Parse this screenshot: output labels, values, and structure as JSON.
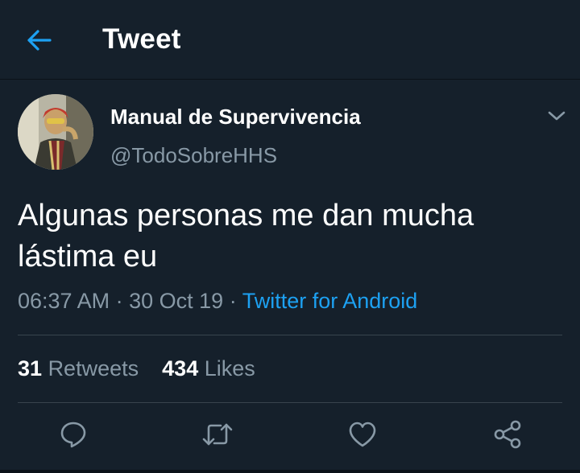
{
  "header": {
    "title": "Tweet",
    "back_icon": "arrow-left-icon"
  },
  "tweet": {
    "author": {
      "display_name": "Manual de Supervivencia",
      "handle": "@TodoSobreHHS"
    },
    "text_line1": "Algunas personas me dan mucha",
    "text_line2": "lástima eu",
    "time": "06:37 AM",
    "date": "30 Oct 19",
    "separator": "·",
    "source": "Twitter for Android",
    "retweets_count": "31",
    "retweets_label": "Retweets",
    "likes_count": "434",
    "likes_label": "Likes"
  },
  "actions": {
    "reply_icon": "reply-icon",
    "retweet_icon": "retweet-icon",
    "like_icon": "heart-icon",
    "share_icon": "share-icon"
  },
  "colors": {
    "background": "#15202b",
    "accent": "#1da1f2",
    "secondary_text": "#8899a6",
    "divider": "#38444d"
  }
}
